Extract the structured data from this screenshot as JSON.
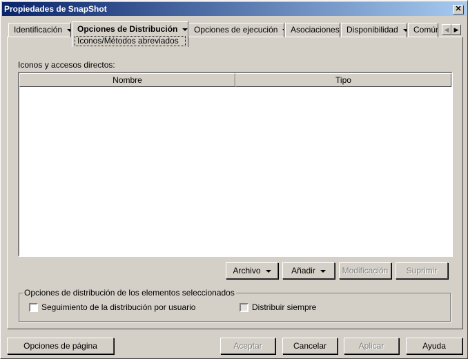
{
  "window": {
    "title": "Propiedades de SnapShot",
    "close": "✕"
  },
  "tabs": [
    {
      "label": "Identificación"
    },
    {
      "label": "Opciones de Distribución",
      "subtab": "Iconos/Métodos abreviados"
    },
    {
      "label": "Opciones de ejecución"
    },
    {
      "label": "Asociaciones"
    },
    {
      "label": "Disponibilidad"
    },
    {
      "label": "Común"
    }
  ],
  "tab_scroll": {
    "left": "◀",
    "right": "▶"
  },
  "main": {
    "list_label": "Iconos y accesos directos:",
    "columns": [
      "Nombre",
      "Tipo"
    ],
    "buttons": {
      "archivo": "Archivo",
      "anadir": "Añadir",
      "modificacion": "Modificación",
      "suprimir": "Suprimir"
    },
    "group_label": "Opciones de distribución de los elementos seleccionados",
    "checkbox_user": "Seguimiento de la distribución por usuario",
    "checkbox_always": "Distribuir siempre"
  },
  "footer": {
    "page_options": "Opciones de página",
    "accept": "Aceptar",
    "cancel": "Cancelar",
    "apply": "Aplicar",
    "help": "Ayuda"
  }
}
